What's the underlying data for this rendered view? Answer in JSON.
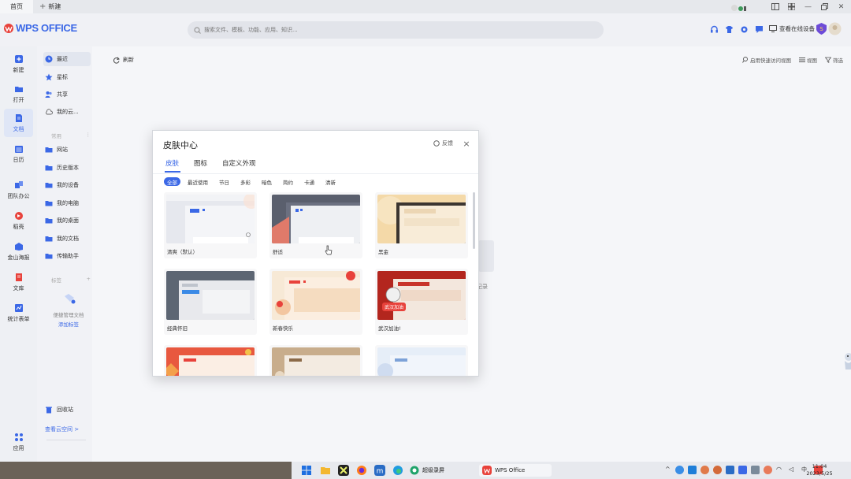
{
  "tabs": {
    "home": "首页",
    "new": "新建"
  },
  "header": {
    "logo_text": "WPS OFFICE",
    "search_placeholder": "搜索文件、模板、功能、应用、知识...",
    "device_label": "查看在线设备"
  },
  "rail": [
    {
      "label": "新建",
      "icon": "plus-square-icon"
    },
    {
      "label": "打开",
      "icon": "folder-open-icon"
    },
    {
      "label": "文档",
      "icon": "document-icon"
    },
    {
      "label": "日历",
      "icon": "calendar-icon"
    },
    {
      "label": "团队办公",
      "icon": "team-icon"
    },
    {
      "label": "稻壳",
      "icon": "daoke-icon"
    },
    {
      "label": "金山海报",
      "icon": "poster-icon"
    },
    {
      "label": "文库",
      "icon": "library-icon"
    },
    {
      "label": "统计表单",
      "icon": "form-icon"
    },
    {
      "label": "应用",
      "icon": "apps-grid-icon"
    }
  ],
  "side": {
    "main_items": [
      "最近",
      "星标",
      "共享",
      "我的云..."
    ],
    "section_common": "常用",
    "common_items": [
      "网站",
      "历史版本",
      "我的设备",
      "我的电脑",
      "我的桌面",
      "我的文档",
      "传输助手"
    ],
    "section_tags": "标签",
    "tags_empty_text": "便捷管理文档",
    "tags_add_link": "添加标签",
    "recycle": "回收站",
    "cloud_space": "查看云空间 >"
  },
  "main": {
    "refresh": "刷新",
    "tool_quick": "启用快速访问视图",
    "tool_view": "视图",
    "tool_filter": "筛选",
    "empty_hint": "记录"
  },
  "modal": {
    "title": "皮肤中心",
    "feedback": "反馈",
    "tabs": [
      "皮肤",
      "图标",
      "自定义外观"
    ],
    "categories": [
      "全部",
      "最近使用",
      "节日",
      "多彩",
      "暗色",
      "简约",
      "卡通",
      "清新"
    ],
    "cards": [
      {
        "name": "清爽（默认）"
      },
      {
        "name": "舒适"
      },
      {
        "name": "黑金"
      },
      {
        "name": "经典怀旧"
      },
      {
        "name": "新春快乐"
      },
      {
        "name": "武汉加油!"
      },
      {
        "name": ""
      },
      {
        "name": ""
      },
      {
        "name": ""
      }
    ]
  },
  "taskbar": {
    "app_recorder": "超级录屏",
    "app_wps": "WPS Office",
    "time": "11:04",
    "date": "2023/5/25"
  },
  "colors": {
    "accent": "#3b68e6",
    "wps_red": "#e8423b"
  }
}
